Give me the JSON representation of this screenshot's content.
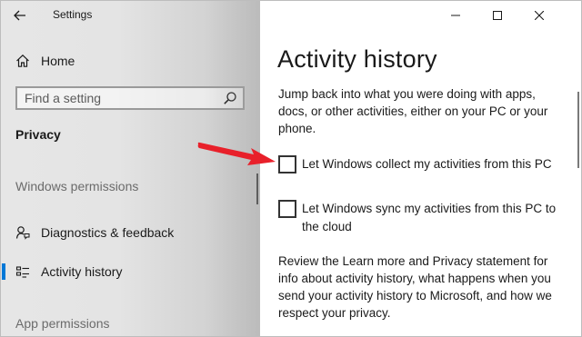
{
  "window": {
    "app_title": "Settings",
    "caption_buttons": [
      "minimize",
      "maximize",
      "close"
    ]
  },
  "sidebar": {
    "home_label": "Home",
    "search": {
      "placeholder": "Find a setting",
      "value": ""
    },
    "section_title": "Privacy",
    "groups": [
      {
        "heading": "Windows permissions",
        "items": [
          {
            "label": "Diagnostics & feedback",
            "icon": "feedback-icon",
            "selected": false
          },
          {
            "label": "Activity history",
            "icon": "activity-history-icon",
            "selected": true
          }
        ]
      },
      {
        "heading": "App permissions",
        "items": []
      }
    ]
  },
  "main": {
    "title": "Activity history",
    "intro": "Jump back into what you were doing with apps, docs, or other activities, either on your PC or your phone.",
    "checkboxes": [
      {
        "label": "Let Windows collect my activities from this PC",
        "checked": false
      },
      {
        "label": "Let Windows sync my activities from this PC to the cloud",
        "checked": false
      }
    ],
    "review_text": "Review the Learn more and Privacy statement for info about activity history, what happens when you send your activity history to Microsoft, and how we respect your privacy."
  },
  "annotation": {
    "arrow_color": "#e8202a"
  },
  "colors": {
    "accent": "#0078d7",
    "text": "#1a1a1a",
    "muted_text": "#6b6b6b"
  }
}
